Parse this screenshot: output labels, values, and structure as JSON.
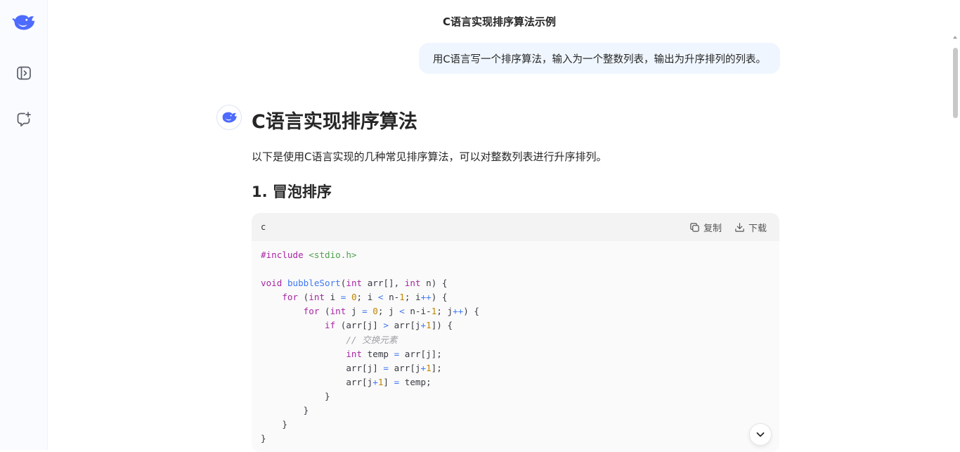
{
  "header": {
    "title": "C语言实现排序算法示例"
  },
  "sidebar": {
    "logo_icon": "deepseek-whale-logo",
    "toggle_icon": "sidebar-toggle-icon",
    "new_chat_icon": "new-chat-icon"
  },
  "user_message": {
    "text": "用C语言写一个排序算法，输入为一个整数列表，输出为升序排列的列表。"
  },
  "answer": {
    "heading": "C语言实现排序算法",
    "intro": "以下是使用C语言实现的几种常见排序算法，可以对整数列表进行升序排列。",
    "section_title": "1. 冒泡排序"
  },
  "code_block": {
    "language": "c",
    "copy_label": "复制",
    "download_label": "下载",
    "code": "#include <stdio.h>\n\nvoid bubbleSort(int arr[], int n) {\n    for (int i = 0; i < n-1; i++) {\n        for (int j = 0; j < n-i-1; j++) {\n            if (arr[j] > arr[j+1]) {\n                // 交换元素\n                int temp = arr[j];\n                arr[j] = arr[j+1];\n                arr[j+1] = temp;\n            }\n        }\n    }\n}"
  },
  "colors": {
    "accent": "#4d6bfe",
    "user_bubble": "#eff6ff",
    "sidebar_bg": "#f9fbff"
  }
}
